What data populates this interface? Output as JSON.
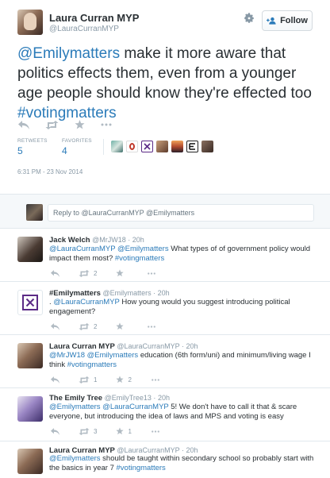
{
  "main_tweet": {
    "author_name": "Laura Curran MYP",
    "author_handle": "@LauraCurranMYP",
    "follow_label": "Follow",
    "text_mention": "@Emilymatters",
    "text_body": " make it more aware that politics effects them, even from a younger age people should know they're effected too ",
    "text_hashtag": "#votingmatters",
    "retweets_label": "RETWEETS",
    "retweets_count": "5",
    "favorites_label": "FAVORITES",
    "favorites_count": "4",
    "timestamp": "6:31 PM - 23 Nov 2014"
  },
  "reply_box": {
    "placeholder": "Reply to @LauraCurranMYP @Emilymatters"
  },
  "replies": [
    {
      "name": "Jack Welch",
      "handle": "@MrJW18",
      "sep": "·",
      "time": "20h",
      "mentions": "@LauraCurranMYP @Emilymatters",
      "body": " What types of of government policy would impact them most? ",
      "hashtag": "#votingmatters",
      "retweets": "2",
      "favorites": ""
    },
    {
      "name": "#Emilymatters",
      "handle": "@Emilymatters",
      "sep": "·",
      "time": "20h",
      "prefix": ". ",
      "mentions": "@LauraCurranMYP",
      "body": " How young would you suggest introducing political engagement?",
      "retweets": "2",
      "favorites": ""
    },
    {
      "name": "Laura Curran MYP",
      "handle": "@LauraCurranMYP",
      "sep": "·",
      "time": "20h",
      "mentions": "@MrJW18 @Emilymatters",
      "body": " education (6th form/uni) and minimum/living wage I think ",
      "hashtag": "#votingmatters",
      "retweets": "1",
      "favorites": "2"
    },
    {
      "name": "The Emily Tree",
      "handle": "@EmilyTree13",
      "sep": "·",
      "time": "20h",
      "mentions": "@Emilymatters @LauraCurranMYP",
      "body": " 5! We don't have to call it that & scare everyone, but introducing the idea of laws and MPS and voting is easy",
      "retweets": "3",
      "favorites": "1"
    },
    {
      "name": "Laura Curran MYP",
      "handle": "@LauraCurranMYP",
      "sep": "·",
      "time": "20h",
      "mentions": "@Emilymatters",
      "body": " should be taught within secondary school so probably start with the basics in year 7 ",
      "hashtag": "#votingmatters"
    }
  ],
  "colors": {
    "link": "#2b7bb9",
    "muted": "#8899a6",
    "text": "#292f33",
    "emily_brand": "#5b2a86"
  }
}
